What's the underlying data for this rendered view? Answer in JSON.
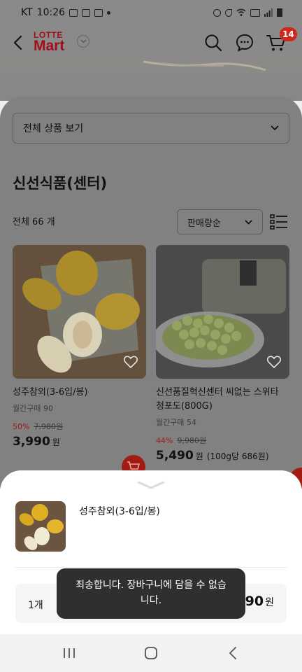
{
  "status_bar": {
    "carrier": "KT",
    "time": "10:26"
  },
  "header": {
    "logo_top": "LOTTE",
    "logo_bottom": "Mart",
    "cart_count": "14"
  },
  "filter": {
    "all_products_label": "전체 상품 보기"
  },
  "category": {
    "title": "신선식품(센터)"
  },
  "listing": {
    "total_label": "전체 66 개",
    "sort_label": "판매량순"
  },
  "products": [
    {
      "name": "성주참외(3-6입/봉)",
      "monthly": "월간구매 90",
      "discount": "50%",
      "original_price": "7,980원",
      "price": "3,990",
      "won": "원"
    },
    {
      "name_line1": "신선품질혁신센터 씨없는 스위타",
      "name_line2": "청포도(800G)",
      "monthly": "월간구매 54",
      "discount": "44%",
      "original_price": "9,980원",
      "price": "5,490",
      "won": "원",
      "unit_price": "(100g당 686원)"
    }
  ],
  "sheet": {
    "product_name": "성주참외(3-6입/봉)",
    "quantity": "1개",
    "price": "3,990",
    "won": "원"
  },
  "toast": {
    "line1": "죄송합니다. 장바구니에 담을 수 없습",
    "line2": "니다."
  },
  "colors": {
    "brand_red": "#d0271b",
    "overlay_grey": "#818181",
    "toast_bg": "#2f2f2f"
  }
}
